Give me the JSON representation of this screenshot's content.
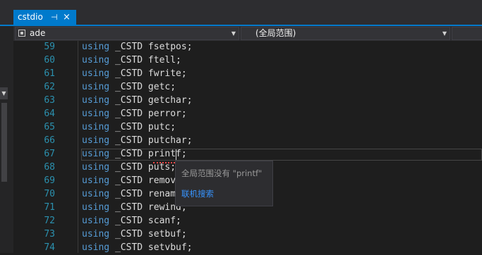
{
  "tab": {
    "title": "cstdio",
    "pin_glyph": "⊣",
    "close_glyph": "×"
  },
  "navbar": {
    "project_dropdown": "ade",
    "scope_dropdown": "(全局范围)",
    "arrow": "▼"
  },
  "side": {
    "arrow": "▼"
  },
  "editor": {
    "current_line_number": 67,
    "lines": [
      {
        "num": "59",
        "kw": "using",
        "rest": " _CSTD fsetpos;"
      },
      {
        "num": "60",
        "kw": "using",
        "rest": " _CSTD ftell;"
      },
      {
        "num": "61",
        "kw": "using",
        "rest": " _CSTD fwrite;"
      },
      {
        "num": "62",
        "kw": "using",
        "rest": " _CSTD getc;"
      },
      {
        "num": "63",
        "kw": "using",
        "rest": " _CSTD getchar;"
      },
      {
        "num": "64",
        "kw": "using",
        "rest": " _CSTD perror;"
      },
      {
        "num": "65",
        "kw": "using",
        "rest": " _CSTD putc;"
      },
      {
        "num": "66",
        "kw": "using",
        "rest": " _CSTD putchar;"
      },
      {
        "num": "67",
        "kw": "using",
        "rest": " _CSTD printf;"
      },
      {
        "num": "68",
        "kw": "using",
        "rest": " _CSTD puts;"
      },
      {
        "num": "69",
        "kw": "using",
        "rest": " _CSTD remove;"
      },
      {
        "num": "70",
        "kw": "using",
        "rest": " _CSTD rename;"
      },
      {
        "num": "71",
        "kw": "using",
        "rest": " _CSTD rewind;"
      },
      {
        "num": "72",
        "kw": "using",
        "rest": " _CSTD scanf;"
      },
      {
        "num": "73",
        "kw": "using",
        "rest": " _CSTD setbuf;"
      },
      {
        "num": "74",
        "kw": "using",
        "rest": " _CSTD setvbuf;"
      }
    ]
  },
  "tooltip": {
    "message": "全局范围没有 \"printf\"",
    "link": "联机搜索"
  },
  "colors": {
    "accent": "#007acc",
    "keyword": "#569cd6",
    "line_number": "#2b91af",
    "error_squiggle": "#f44747"
  }
}
